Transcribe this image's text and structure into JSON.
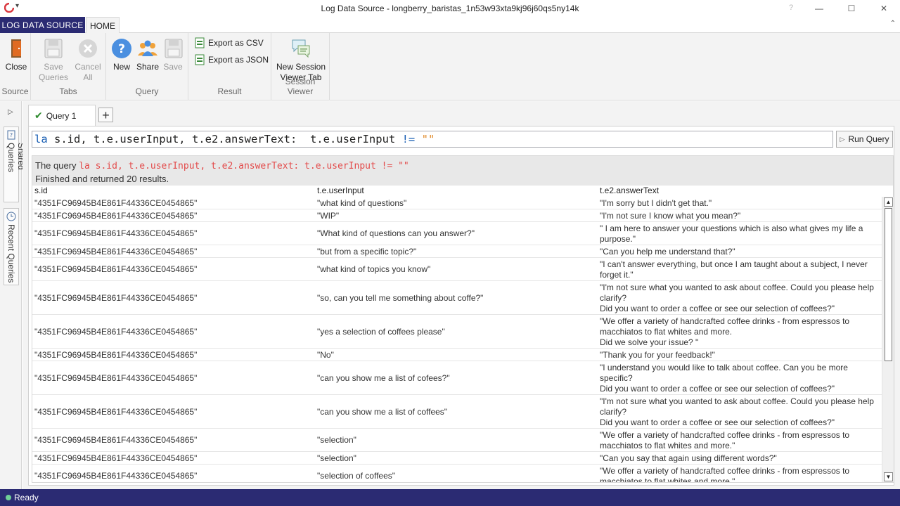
{
  "window": {
    "title": "Log Data Source - longberry_baristas_1n53w93xta9kj96j60qs5ny14k",
    "help": "?",
    "minimize": "—",
    "maximize": "☐",
    "close": "✕"
  },
  "ribbon_tabs": {
    "file": "LOG DATA SOURCE",
    "home": "HOME"
  },
  "ribbon": {
    "groups": {
      "source": "Source",
      "tabs": "Tabs",
      "query": "Query",
      "result": "Result",
      "session_viewer": "Session Viewer"
    },
    "buttons": {
      "close": "Close",
      "save_queries_1": "Save",
      "save_queries_2": "Queries",
      "cancel_all_1": "Cancel",
      "cancel_all_2": "All",
      "new": "New",
      "share": "Share",
      "save": "Save",
      "export_csv": "Export as CSV",
      "export_json": "Export as JSON",
      "new_session_1": "New Session",
      "new_session_2": "Viewer Tab"
    }
  },
  "side": {
    "shared_queries": "Shared Queries",
    "recent_queries": "Recent Queries"
  },
  "query_tab": {
    "label": "Query 1",
    "add": "+"
  },
  "query": {
    "kw": "la",
    "body": " s.id, t.e.userInput, t.e2.answerText:  t.e.userInput ",
    "op": "!=",
    "space": " ",
    "str": "\"\"",
    "run_label": "Run Query"
  },
  "result": {
    "prefix": "The query ",
    "query_text": "la s.id, t.e.userInput, t.e2.answerText:  t.e.userInput != \"\"",
    "status": "Finished and returned 20 results."
  },
  "columns": [
    "s.id",
    "t.e.userInput",
    "t.e2.answerText"
  ],
  "rows": [
    {
      "id": "\"4351FC96945B4E861F44336CE0454865\"",
      "input": "\"what kind of questions\"",
      "answer": "\"I'm sorry but I didn't get that.\""
    },
    {
      "id": "\"4351FC96945B4E861F44336CE0454865\"",
      "input": "\"WIP\"",
      "answer": "\"I'm not sure I know what you mean?\""
    },
    {
      "id": "\"4351FC96945B4E861F44336CE0454865\"",
      "input": "\"What kind of questions can you answer?\"",
      "answer": "\" I am here to answer your questions which is also what gives my life a\npurpose.\""
    },
    {
      "id": "\"4351FC96945B4E861F44336CE0454865\"",
      "input": "\"but from a specific topic?\"",
      "answer": "\"Can you help me understand that?\""
    },
    {
      "id": "\"4351FC96945B4E861F44336CE0454865\"",
      "input": "\"what kind of topics you know\"",
      "answer": "\"I can't answer everything, but once I am taught about a subject, I never\nforget it.\""
    },
    {
      "id": "\"4351FC96945B4E861F44336CE0454865\"",
      "input": "\"so, can you tell me something about coffe?\"",
      "answer": "\"I'm not sure what you wanted to ask about coffee. Could you please help\nclarify?\nDid you want to order a coffee or see our selection of coffees?\""
    },
    {
      "id": "\"4351FC96945B4E861F44336CE0454865\"",
      "input": "\"yes a selection of coffees please\"",
      "answer": "\"We offer a variety of handcrafted coffee drinks - from espressos to\nmacchiatos to flat whites and more.\nDid we solve your issue? \""
    },
    {
      "id": "\"4351FC96945B4E861F44336CE0454865\"",
      "input": "\"No\"",
      "answer": "\"Thank you for your feedback!\""
    },
    {
      "id": "\"4351FC96945B4E861F44336CE0454865\"",
      "input": "\"can you show me a list of cofees?\"",
      "answer": "\"I understand you would like to talk about coffee. Can you be more\nspecific?\nDid you want to order a coffee or see our selection of coffees?\""
    },
    {
      "id": "\"4351FC96945B4E861F44336CE0454865\"",
      "input": "\"can you show me a list of coffees\"",
      "answer": "\"I'm not sure what you wanted to ask about coffee. Could you please help\nclarify?\nDid you want to order a coffee or see our selection of coffees?\""
    },
    {
      "id": "\"4351FC96945B4E861F44336CE0454865\"",
      "input": "\"selection\"",
      "answer": "\"We offer a variety of handcrafted coffee drinks - from espressos to\nmacchiatos to flat whites and more.\""
    },
    {
      "id": "\"4351FC96945B4E861F44336CE0454865\"",
      "input": "\"selection\"",
      "answer": "\"Can you say that again using different words?\""
    },
    {
      "id": "\"4351FC96945B4E861F44336CE0454865\"",
      "input": "\"selection of coffees\"",
      "answer": "\"We offer a variety of handcrafted coffee drinks - from espressos to\nmacchiatos to flat whites and more.\""
    }
  ],
  "status": {
    "text": "Ready"
  },
  "colors": {
    "brand": "#2b2b73",
    "keyword": "#1a5fb4",
    "string": "#e08a2a",
    "query_echo": "#e34b4b",
    "ok": "#2e8b2e"
  },
  "icons": [
    "app-logo-icon",
    "quick-access-arrow-icon",
    "close-door-icon",
    "save-queries-icon",
    "cancel-all-icon",
    "new-query-help-icon",
    "share-people-icon",
    "save-disk-icon",
    "csv-file-icon",
    "json-file-icon",
    "session-viewer-chat-icon",
    "expand-panel-icon",
    "shared-queries-icon",
    "recent-queries-clock-icon",
    "checkmark-icon",
    "run-triangle-icon",
    "scroll-up-icon",
    "scroll-down-icon",
    "status-dot-icon"
  ]
}
